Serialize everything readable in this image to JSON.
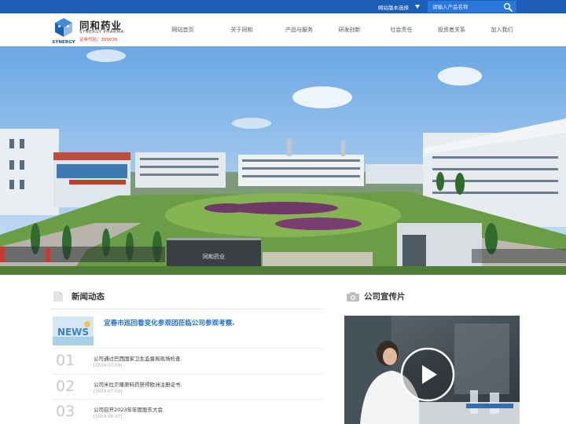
{
  "topbar": {
    "version_select": "网站版本选择",
    "search_placeholder": "请输入产品名称"
  },
  "header": {
    "brand_cn": "同和药业",
    "brand_en": "SYNERGY PHARMA",
    "logo_text": "SYNERGY",
    "stock_code": "证券代码：300636"
  },
  "nav": [
    {
      "label": "网站首页"
    },
    {
      "label": "关于同和"
    },
    {
      "label": "产品与服务"
    },
    {
      "label": "研发创新"
    },
    {
      "label": "社会责任"
    },
    {
      "label": "投资者关系"
    },
    {
      "label": "加入我们"
    }
  ],
  "banner": {
    "gate_sign": "同和药业"
  },
  "news": {
    "title": "新闻动态",
    "feature": {
      "thumb_text": "NEWS",
      "title": "宜春市巡回看变化参观团莅临公司参观考察."
    },
    "items": [
      {
        "num": "01",
        "title": "公司通过巴西国家卫生监督局现场检查.",
        "date": "[2024-07-09]"
      },
      {
        "num": "02",
        "title": "公司米拉贝隆原料药获得欧洲注册证书.",
        "date": "[2024-07-09]"
      },
      {
        "num": "03",
        "title": "公司召开2023年年度股东大会.",
        "date": "[2024-06-07]"
      }
    ]
  },
  "video": {
    "title": "公司宣传片"
  },
  "colors": {
    "primary_blue": "#1d5fb8",
    "accent_blue": "#1e6fd0",
    "stock_red": "#d9332b"
  }
}
